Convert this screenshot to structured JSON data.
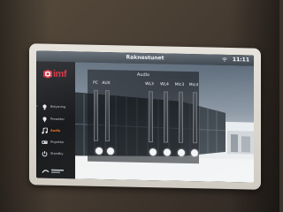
{
  "header": {
    "title": "Raknestunet",
    "clock": "11:11"
  },
  "sidebar": {
    "logo_text": "imf",
    "items": [
      {
        "label": "Belysning",
        "icon": "bulb-icon"
      },
      {
        "label": "Presetter",
        "icon": "pin-icon"
      },
      {
        "label": "Audio",
        "icon": "note-icon",
        "active": true
      },
      {
        "label": "Projektor",
        "icon": "projector-icon"
      },
      {
        "label": "Standby",
        "icon": "power-icon"
      }
    ],
    "powered_by_icon": "brand-mark-icon"
  },
  "audio": {
    "title": "Audio",
    "channels": [
      "PC",
      "AUX",
      "WL3",
      "WL4",
      "Mic3",
      "Mic4"
    ]
  },
  "colors": {
    "accent": "#d62e3c",
    "active_nav": "#ff7a2a",
    "topbar": "#4a535d"
  }
}
